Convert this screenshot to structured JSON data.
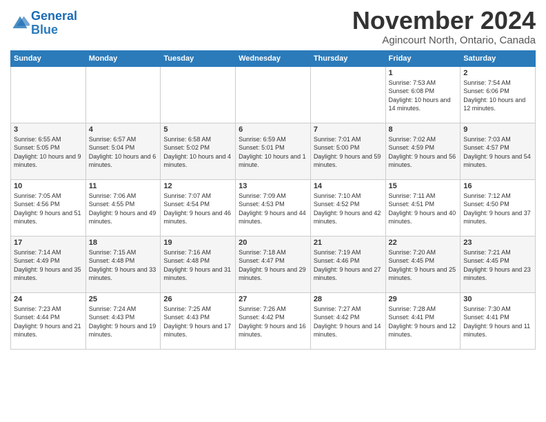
{
  "header": {
    "logo_line1": "General",
    "logo_line2": "Blue",
    "month": "November 2024",
    "location": "Agincourt North, Ontario, Canada"
  },
  "weekdays": [
    "Sunday",
    "Monday",
    "Tuesday",
    "Wednesday",
    "Thursday",
    "Friday",
    "Saturday"
  ],
  "weeks": [
    [
      {
        "day": "",
        "info": ""
      },
      {
        "day": "",
        "info": ""
      },
      {
        "day": "",
        "info": ""
      },
      {
        "day": "",
        "info": ""
      },
      {
        "day": "",
        "info": ""
      },
      {
        "day": "1",
        "info": "Sunrise: 7:53 AM\nSunset: 6:08 PM\nDaylight: 10 hours and 14 minutes."
      },
      {
        "day": "2",
        "info": "Sunrise: 7:54 AM\nSunset: 6:06 PM\nDaylight: 10 hours and 12 minutes."
      }
    ],
    [
      {
        "day": "3",
        "info": "Sunrise: 6:55 AM\nSunset: 5:05 PM\nDaylight: 10 hours and 9 minutes."
      },
      {
        "day": "4",
        "info": "Sunrise: 6:57 AM\nSunset: 5:04 PM\nDaylight: 10 hours and 6 minutes."
      },
      {
        "day": "5",
        "info": "Sunrise: 6:58 AM\nSunset: 5:02 PM\nDaylight: 10 hours and 4 minutes."
      },
      {
        "day": "6",
        "info": "Sunrise: 6:59 AM\nSunset: 5:01 PM\nDaylight: 10 hours and 1 minute."
      },
      {
        "day": "7",
        "info": "Sunrise: 7:01 AM\nSunset: 5:00 PM\nDaylight: 9 hours and 59 minutes."
      },
      {
        "day": "8",
        "info": "Sunrise: 7:02 AM\nSunset: 4:59 PM\nDaylight: 9 hours and 56 minutes."
      },
      {
        "day": "9",
        "info": "Sunrise: 7:03 AM\nSunset: 4:57 PM\nDaylight: 9 hours and 54 minutes."
      }
    ],
    [
      {
        "day": "10",
        "info": "Sunrise: 7:05 AM\nSunset: 4:56 PM\nDaylight: 9 hours and 51 minutes."
      },
      {
        "day": "11",
        "info": "Sunrise: 7:06 AM\nSunset: 4:55 PM\nDaylight: 9 hours and 49 minutes."
      },
      {
        "day": "12",
        "info": "Sunrise: 7:07 AM\nSunset: 4:54 PM\nDaylight: 9 hours and 46 minutes."
      },
      {
        "day": "13",
        "info": "Sunrise: 7:09 AM\nSunset: 4:53 PM\nDaylight: 9 hours and 44 minutes."
      },
      {
        "day": "14",
        "info": "Sunrise: 7:10 AM\nSunset: 4:52 PM\nDaylight: 9 hours and 42 minutes."
      },
      {
        "day": "15",
        "info": "Sunrise: 7:11 AM\nSunset: 4:51 PM\nDaylight: 9 hours and 40 minutes."
      },
      {
        "day": "16",
        "info": "Sunrise: 7:12 AM\nSunset: 4:50 PM\nDaylight: 9 hours and 37 minutes."
      }
    ],
    [
      {
        "day": "17",
        "info": "Sunrise: 7:14 AM\nSunset: 4:49 PM\nDaylight: 9 hours and 35 minutes."
      },
      {
        "day": "18",
        "info": "Sunrise: 7:15 AM\nSunset: 4:48 PM\nDaylight: 9 hours and 33 minutes."
      },
      {
        "day": "19",
        "info": "Sunrise: 7:16 AM\nSunset: 4:48 PM\nDaylight: 9 hours and 31 minutes."
      },
      {
        "day": "20",
        "info": "Sunrise: 7:18 AM\nSunset: 4:47 PM\nDaylight: 9 hours and 29 minutes."
      },
      {
        "day": "21",
        "info": "Sunrise: 7:19 AM\nSunset: 4:46 PM\nDaylight: 9 hours and 27 minutes."
      },
      {
        "day": "22",
        "info": "Sunrise: 7:20 AM\nSunset: 4:45 PM\nDaylight: 9 hours and 25 minutes."
      },
      {
        "day": "23",
        "info": "Sunrise: 7:21 AM\nSunset: 4:45 PM\nDaylight: 9 hours and 23 minutes."
      }
    ],
    [
      {
        "day": "24",
        "info": "Sunrise: 7:23 AM\nSunset: 4:44 PM\nDaylight: 9 hours and 21 minutes."
      },
      {
        "day": "25",
        "info": "Sunrise: 7:24 AM\nSunset: 4:43 PM\nDaylight: 9 hours and 19 minutes."
      },
      {
        "day": "26",
        "info": "Sunrise: 7:25 AM\nSunset: 4:43 PM\nDaylight: 9 hours and 17 minutes."
      },
      {
        "day": "27",
        "info": "Sunrise: 7:26 AM\nSunset: 4:42 PM\nDaylight: 9 hours and 16 minutes."
      },
      {
        "day": "28",
        "info": "Sunrise: 7:27 AM\nSunset: 4:42 PM\nDaylight: 9 hours and 14 minutes."
      },
      {
        "day": "29",
        "info": "Sunrise: 7:28 AM\nSunset: 4:41 PM\nDaylight: 9 hours and 12 minutes."
      },
      {
        "day": "30",
        "info": "Sunrise: 7:30 AM\nSunset: 4:41 PM\nDaylight: 9 hours and 11 minutes."
      }
    ]
  ]
}
